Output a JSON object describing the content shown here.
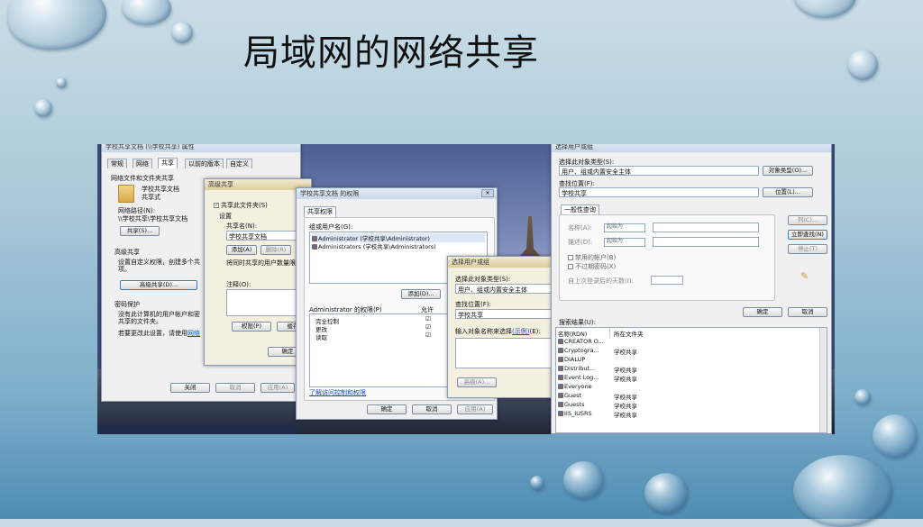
{
  "slide": {
    "title": "局域网的网络共享"
  },
  "props": {
    "title": "学校共享文档 (\\\\学校共享) 属性",
    "tabs": [
      "常规",
      "网络",
      "共享",
      "以前的版本",
      "自定义"
    ],
    "section1": "网络文件和文件夹共享",
    "folder_name": "学校共享文档",
    "folder_state": "共享式",
    "path_label": "网络路径(N):",
    "path_value": "\\\\学校共享\\学校共享文档",
    "share_btn": "共享(S)...",
    "adv_section": "高级共享",
    "adv_desc1": "设置自定义权限，创建多个共",
    "adv_desc2": "项。",
    "adv_btn": "高级共享(D)...",
    "pw_section": "密码保护",
    "pw_desc1": "没有此计算机的用户帐户和密",
    "pw_desc2": "共享的文件夹。",
    "pw_desc3": "若要更改此设置，请使用",
    "pw_link": "网络",
    "close_btn": "关闭",
    "cancel_btn": "取消",
    "apply_btn": "应用(A)"
  },
  "adv": {
    "title": "高级共享",
    "share_check": "共享此文件夹(S)",
    "settings": "设置",
    "share_name_label": "共享名(N):",
    "share_name": "学校共享文档",
    "add_btn": "添加(A)",
    "remove_btn": "删除(R)",
    "limit_label": "将同时共享的用户数量限",
    "comment_label": "注释(O):",
    "perm_btn": "权限(P)",
    "cache_btn": "缓存",
    "ok_btn": "确定"
  },
  "perm": {
    "title": "学校共享文档 的权限",
    "close": "✕",
    "tab": "共享权限",
    "group_label": "组或用户名(G):",
    "users": [
      "Administrator (学校共享\\Administrator)",
      "Administrators (学校共享\\Administrators)"
    ],
    "add_btn": "添加(D)...",
    "perm_label": "Administrator 的权限(P)",
    "allow_col": "允许",
    "perms": [
      "完全控制",
      "更改",
      "读取"
    ],
    "perm_marks": [
      "☑",
      "☑",
      "☑"
    ],
    "link": "了解访问控制和权限",
    "ok_btn": "确定",
    "cancel_btn": "取消",
    "apply_btn": "应用(A)"
  },
  "selsmall": {
    "title": "选择用户或组",
    "type_label": "选择此对象类型(S):",
    "type_value": "用户、组或内置安全主体",
    "loc_label": "查找位置(F):",
    "loc_value": "学校共享",
    "enter_label": "输入对象名称来选择",
    "enter_link": "(示例)",
    "enter_suffix": "(E):",
    "adv_btn": "高级(A)..."
  },
  "sel": {
    "title": "选择用户或组",
    "type_label": "选择此对象类型(S):",
    "type_value": "用户、组或内置安全主体",
    "type_btn": "对象类型(O)...",
    "loc_label": "查找位置(F):",
    "loc_value": "学校共享",
    "loc_btn": "位置(L)...",
    "tab": "一般性查询",
    "name_label": "名称(A):",
    "desc_label": "描述(D):",
    "starts": "起始为",
    "disabled": "禁用的帐户(B)",
    "noexpire": "不过期密码(X)",
    "days_label": "自上次登录后的天数(I):",
    "col_btn": "列(C)...",
    "find_btn": "立即查找(N)",
    "stop_btn": "停止(T)",
    "ok_btn": "确定",
    "cancel_btn": "取消",
    "results_label": "搜索结果(U):",
    "col_name": "名称(RDN)",
    "col_folder": "所在文件夹",
    "rows": [
      {
        "name": "CREATOR O...",
        "folder": ""
      },
      {
        "name": "Cryptogra...",
        "folder": "学校共享"
      },
      {
        "name": "DIALUP",
        "folder": ""
      },
      {
        "name": "Distribut...",
        "folder": "学校共享"
      },
      {
        "name": "Event Log...",
        "folder": "学校共享"
      },
      {
        "name": "Everyone",
        "folder": ""
      },
      {
        "name": "Guest",
        "folder": "学校共享"
      },
      {
        "name": "Guests",
        "folder": "学校共享"
      },
      {
        "name": "IIS_IUSRS",
        "folder": "学校共享"
      }
    ]
  }
}
